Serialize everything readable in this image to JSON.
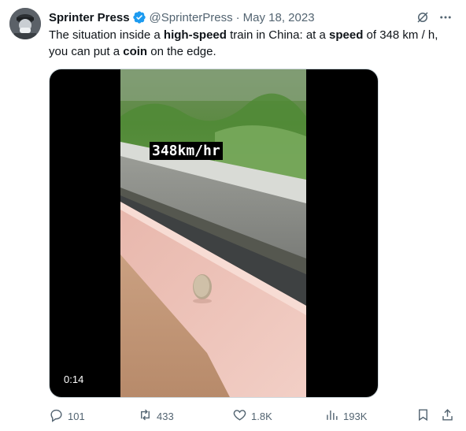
{
  "tweet": {
    "author": {
      "name": "Sprinter Press",
      "handle": "@SprinterPress",
      "separator": "·",
      "date": "May 18, 2023"
    },
    "text": {
      "p1": "The situation inside a ",
      "b1": "high-speed",
      "p2": " train in China: at a ",
      "b2": "speed",
      "p3": " of 348 km / h, you can put a ",
      "b3": "coin",
      "p4": " on the edge."
    },
    "media": {
      "overlay_text": "348km/hr",
      "duration": "0:14"
    },
    "actions": {
      "replies": "101",
      "reposts": "433",
      "likes": "1.8K",
      "views": "193K"
    }
  },
  "icons": {
    "verified": "verified-badge-icon",
    "grok": "grok-icon",
    "more": "more-icon",
    "reply": "reply-icon",
    "repost": "repost-icon",
    "like": "heart-icon",
    "views": "views-icon",
    "bookmark": "bookmark-icon",
    "share": "share-icon"
  },
  "colors": {
    "verified_blue": "#1d9bf0",
    "secondary_text": "#536471"
  }
}
